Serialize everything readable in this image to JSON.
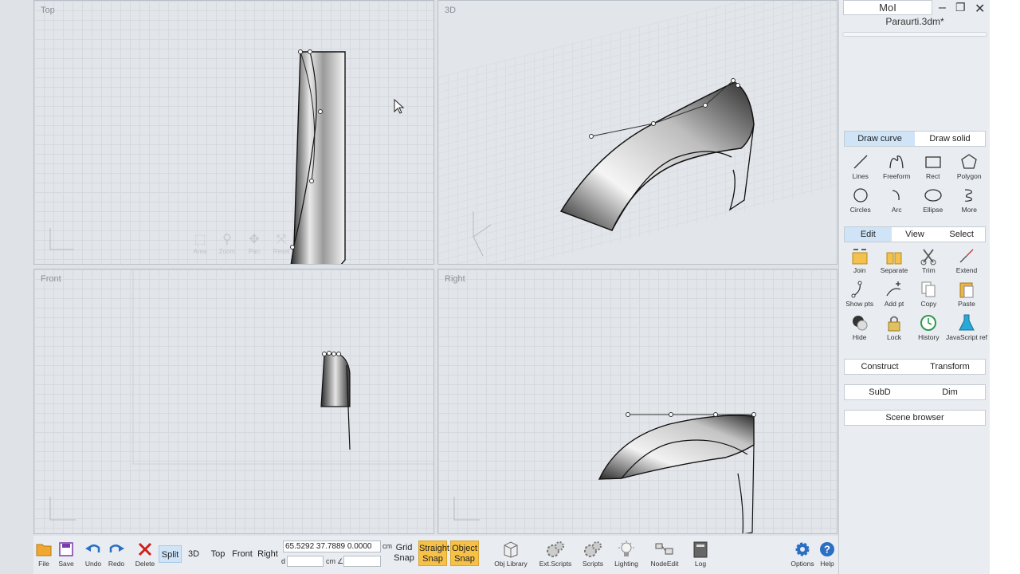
{
  "viewports": {
    "top": "Top",
    "three_d": "3D",
    "front": "Front",
    "right": "Right"
  },
  "nav_tools": [
    "Area",
    "Zoom",
    "Pan",
    "Reset"
  ],
  "panel": {
    "app_title": "MoI",
    "file_name": "Paraurti.3dm*",
    "draw_tabs": [
      "Draw curve",
      "Draw solid"
    ],
    "draw_tools": [
      {
        "label": "Lines",
        "icon": "lines-icon"
      },
      {
        "label": "Freeform",
        "icon": "freeform-icon"
      },
      {
        "label": "Rect",
        "icon": "rect-icon"
      },
      {
        "label": "Polygon",
        "icon": "polygon-icon"
      },
      {
        "label": "Circles",
        "icon": "circle-icon"
      },
      {
        "label": "Arc",
        "icon": "arc-icon"
      },
      {
        "label": "Ellipse",
        "icon": "ellipse-icon"
      },
      {
        "label": "More",
        "icon": "more-icon"
      }
    ],
    "edit_tabs": [
      "Edit",
      "View",
      "Select"
    ],
    "edit_tools": [
      {
        "label": "Join",
        "icon": "join-icon"
      },
      {
        "label": "Separate",
        "icon": "separate-icon"
      },
      {
        "label": "Trim",
        "icon": "trim-icon"
      },
      {
        "label": "Extend",
        "icon": "extend-icon"
      },
      {
        "label": "Show pts",
        "icon": "show-points-icon"
      },
      {
        "label": "Add pt",
        "icon": "add-point-icon"
      },
      {
        "label": "Copy",
        "icon": "copy-icon"
      },
      {
        "label": "Paste",
        "icon": "paste-icon"
      },
      {
        "label": "Hide",
        "icon": "hide-icon"
      },
      {
        "label": "Lock",
        "icon": "lock-icon"
      },
      {
        "label": "History",
        "icon": "history-icon"
      },
      {
        "label": "JavaScript ref",
        "icon": "javascript-ref-icon"
      }
    ],
    "construct": "Construct",
    "transform": "Transform",
    "subd": "SubD",
    "dim": "Dim",
    "scene_browser": "Scene browser"
  },
  "toolbar": {
    "file": "File",
    "save": "Save",
    "undo": "Undo",
    "redo": "Redo",
    "delete": "Delete",
    "views": [
      "Split",
      "3D",
      "Top",
      "Front",
      "Right"
    ],
    "coords": "65.5292  37.7889  0.0000",
    "unit": "cm",
    "d_label": "d",
    "cm2": "cm",
    "angle": "∠",
    "grid_snap_1": "Grid",
    "grid_snap_2": "Snap",
    "straight_snap_1": "Straight",
    "straight_snap_2": "Snap",
    "object_snap_1": "Object",
    "object_snap_2": "Snap",
    "plugins": [
      "Obj Library",
      "Ext.Scripts",
      "Scripts",
      "Lighting",
      "NodeEdit",
      "Log"
    ],
    "options": "Options",
    "help": "Help"
  },
  "colors": {
    "accent": "#cfe4f7",
    "snap_on": "#f6c146",
    "delete_red": "#d0201b",
    "blue_icon": "#2a6fc4"
  }
}
